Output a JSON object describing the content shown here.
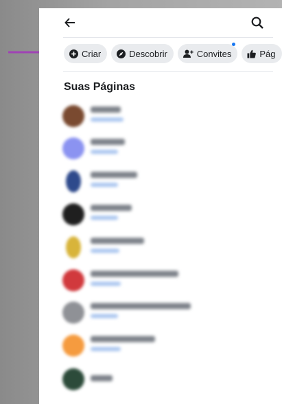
{
  "header": {
    "back_icon": "arrow-left-icon",
    "search_icon": "search-icon"
  },
  "annotation": {
    "arrow_color": "#a043b5",
    "arrow_icon": "arrow-right-icon"
  },
  "chips": [
    {
      "label": "Criar",
      "icon": "plus-circle-icon"
    },
    {
      "label": "Descobrir",
      "icon": "compass-icon"
    },
    {
      "label": "Convites",
      "icon": "add-person-icon",
      "badge_color": "#1877f2"
    },
    {
      "label": "Pág",
      "icon": "thumbs-up-icon"
    }
  ],
  "section": {
    "title": "Suas Páginas"
  },
  "pages": [
    {
      "avatar_color": "#7a4a30"
    },
    {
      "avatar_color": "#8b93f1"
    },
    {
      "avatar_color": "#2e4a8c"
    },
    {
      "avatar_color": "#1f1f1f"
    },
    {
      "avatar_color": "#d8b43a"
    },
    {
      "avatar_color": "#d1393d"
    },
    {
      "avatar_color": "#8f9196"
    },
    {
      "avatar_color": "#f59b3f"
    },
    {
      "avatar_color": "#2c4b3a"
    }
  ],
  "colors": {
    "accent": "#1877f2",
    "chip_bg": "#e9ebee",
    "text": "#1c1e21"
  }
}
